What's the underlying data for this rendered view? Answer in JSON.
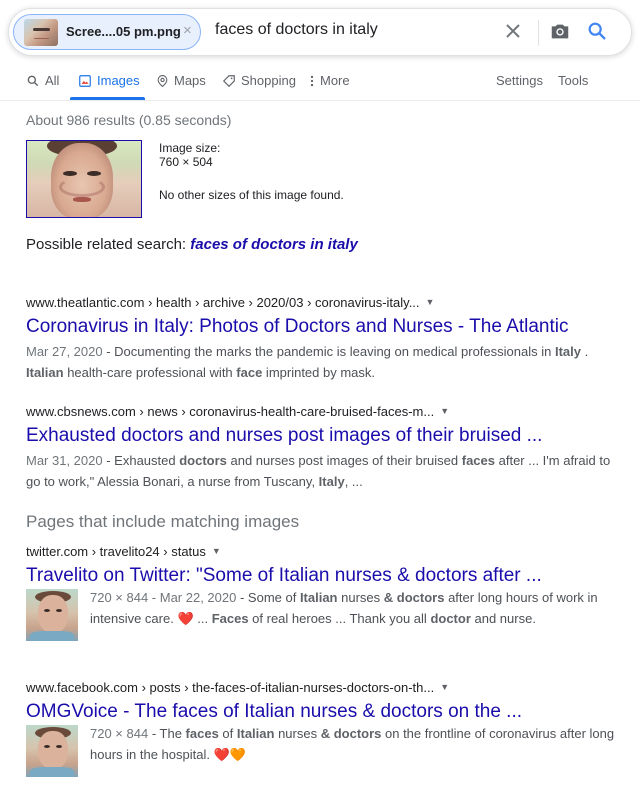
{
  "search": {
    "chip_label": "Scree....05 pm.png",
    "chip_remove": "×",
    "query": "faces of doctors in italy"
  },
  "tabs": [
    {
      "label": "All",
      "icon": "search-icon",
      "active": false
    },
    {
      "label": "Images",
      "icon": "image-icon",
      "active": true
    },
    {
      "label": "Maps",
      "icon": "map-pin-icon",
      "active": false
    },
    {
      "label": "Shopping",
      "icon": "tag-icon",
      "active": false
    },
    {
      "label": "More",
      "icon": "more-vertical-icon",
      "active": false
    }
  ],
  "tools": {
    "settings": "Settings",
    "tools": "Tools"
  },
  "stats": "About 986 results (0.85 seconds)",
  "image_info": {
    "size_label": "Image size:",
    "size_value": "760 × 504",
    "no_other": "No other sizes of this image found."
  },
  "related": {
    "prefix": "Possible related search: ",
    "link": "faces of doctors in italy"
  },
  "results": [
    {
      "crumb": "www.theatlantic.com › health › archive › 2020/03 › coronavirus-italy...",
      "title": "Coronavirus in Italy: Photos of Doctors and Nurses - The Atlantic",
      "date": "Mar 27, 2020",
      "snippet_parts": [
        " - Documenting the marks the pandemic is leaving on medical professionals in ",
        "Italy",
        " . ",
        "Italian",
        " health-care professional with ",
        "face",
        " imprinted by mask."
      ]
    },
    {
      "crumb": "www.cbsnews.com › news › coronavirus-health-care-bruised-faces-m...",
      "title": "Exhausted doctors and nurses post images of their bruised ...",
      "date": "Mar 31, 2020",
      "snippet_parts": [
        " - Exhausted ",
        "doctors",
        " and nurses post images of their bruised ",
        "faces",
        " after ... I'm afraid to go to work,\" Alessia Bonari, a nurse from Tuscany, ",
        "Italy",
        ", ..."
      ]
    }
  ],
  "matching_section": "Pages that include matching images",
  "matching": [
    {
      "crumb": "twitter.com › travelito24 › status",
      "title": "Travelito on Twitter: \"Some of Italian nurses & doctors after ...",
      "meta": "720 × 844 - Mar 22, 2020",
      "snippet_parts": [
        " - Some of ",
        "Italian",
        " nurses ",
        "&",
        " ",
        "doctors",
        " after long hours of work in intensive care. ",
        "❤️",
        " ... ",
        "Faces",
        " of real heroes ... Thank you all ",
        "doctor",
        " and nurse."
      ]
    },
    {
      "crumb": "www.facebook.com › posts › the-faces-of-italian-nurses-doctors-on-th...",
      "title": "OMGVoice - The faces of Italian nurses & doctors on the ...",
      "meta": "720 × 844",
      "snippet_parts": [
        " - The ",
        "faces",
        " of ",
        "Italian",
        " nurses ",
        "&",
        " ",
        "doctors",
        " on the frontline of coronavirus after long hours in the hospital. ",
        "❤️",
        "🧡"
      ]
    }
  ],
  "colors": {
    "link": "#1a0dab",
    "accent": "#1a73e8",
    "muted": "#70757a"
  }
}
